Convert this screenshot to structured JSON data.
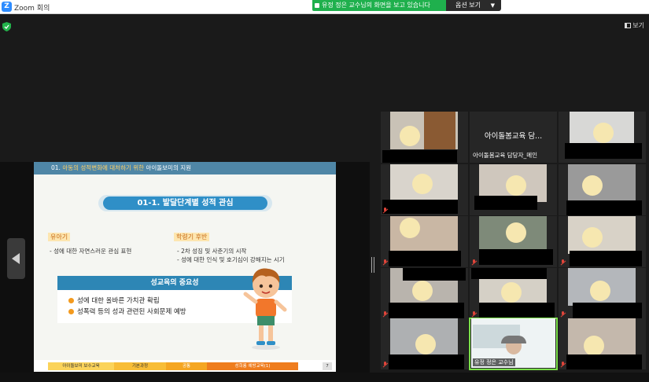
{
  "window": {
    "app_title": "Zoom 회의",
    "logo_letter": "Z"
  },
  "share": {
    "banner_text": "유정 정은 교수님의 화면을 보고 있습니다",
    "view_options_label": "옵션 보기"
  },
  "toolbar": {
    "view_label": "보기"
  },
  "slide": {
    "header_num": "01. ",
    "header_accent": "아동의 성적변화에 대처하기 위한",
    "header_rest": " 아이돌보미의 지원",
    "pill_title": "01-1. 발달단계별 성적 관심",
    "section_left": {
      "label": "유아기",
      "bullets": [
        "- 성에 대한 자연스러운 관심 표현"
      ]
    },
    "section_right": {
      "label": "학령기 후반",
      "bullets": [
        "- 2차 성징 및 사춘기의 시작",
        "- 성에 대한 인식 및 호기심이 강해지는 시기"
      ]
    },
    "edu_box": {
      "title": "성교육의 중요성",
      "items": [
        "성에 대한 올바른 가치관 확립",
        "성폭력 등의 성과 관련된 사회문제 예방"
      ]
    },
    "footer_tabs": [
      "아이돌보미 보수교육",
      "기본과정",
      "공통",
      "성희롱 예방교육(1)"
    ],
    "page_number": "7"
  },
  "participants": [
    {
      "name": ""
    },
    {
      "name": "아이돌봄교육 담...",
      "subtitle": "아이돌봄교육 담당자_메인"
    },
    {
      "name": ""
    },
    {
      "name": ""
    },
    {
      "name": ""
    },
    {
      "name": ""
    },
    {
      "name": ""
    },
    {
      "name": ""
    },
    {
      "name": ""
    },
    {
      "name": ""
    },
    {
      "name": ""
    },
    {
      "name": ""
    },
    {
      "name": ""
    },
    {
      "name": "유정 정은 교수님",
      "active": true
    },
    {
      "name": ""
    }
  ],
  "colors": {
    "banner_green": "#1fb04d",
    "slide_blue": "#2f8fc7",
    "active_border": "#7be04a",
    "muted_red": "#e0453a"
  }
}
